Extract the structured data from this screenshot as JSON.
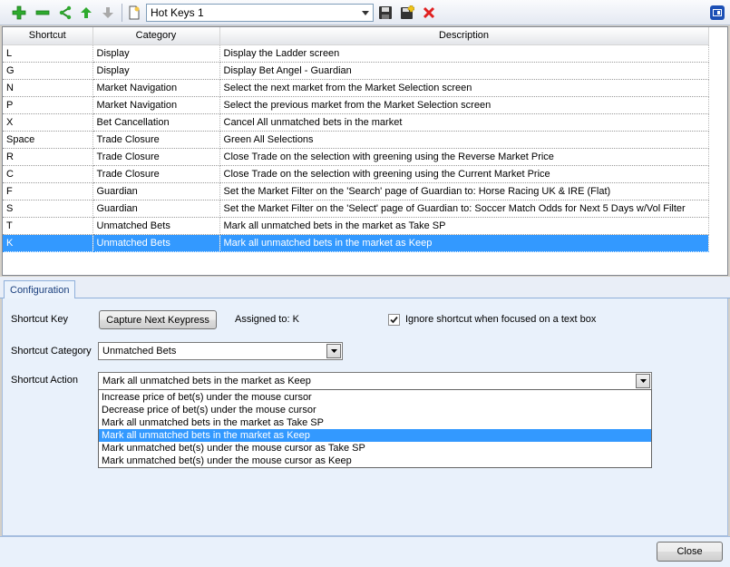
{
  "toolbar": {
    "buttons": [
      "add-icon",
      "remove-icon",
      "share-icon",
      "move-up-icon",
      "move-down-icon",
      "new-file-icon"
    ],
    "preset_name": "Hot Keys 1",
    "actions": [
      "save-icon",
      "save-as-icon",
      "delete-icon"
    ],
    "dock_icon": "dock-icon"
  },
  "grid": {
    "columns": [
      "Shortcut",
      "Category",
      "Description"
    ],
    "rows": [
      [
        "L",
        "Display",
        "Display the Ladder screen"
      ],
      [
        "G",
        "Display",
        "Display Bet Angel - Guardian"
      ],
      [
        "N",
        "Market Navigation",
        "Select the next market from the Market Selection screen"
      ],
      [
        "P",
        "Market Navigation",
        "Select the previous market from the Market Selection screen"
      ],
      [
        "X",
        "Bet Cancellation",
        "Cancel All unmatched bets in the market"
      ],
      [
        "Space",
        "Trade Closure",
        "Green All Selections"
      ],
      [
        "R",
        "Trade Closure",
        "Close Trade on the selection with greening using the Reverse Market Price"
      ],
      [
        "C",
        "Trade Closure",
        "Close Trade on the selection with greening using the Current Market Price"
      ],
      [
        "F",
        "Guardian",
        "Set the Market Filter on the 'Search' page of Guardian to: Horse Racing UK & IRE (Flat)"
      ],
      [
        "S",
        "Guardian",
        "Set the Market Filter on the 'Select' page of Guardian to: Soccer Match Odds for Next 5 Days w/Vol Filter"
      ],
      [
        "T",
        "Unmatched Bets",
        "Mark all unmatched bets in the market as Take SP"
      ],
      [
        "K",
        "Unmatched Bets",
        "Mark all unmatched bets in the market as Keep"
      ]
    ],
    "selected_index": 11
  },
  "tab": {
    "label": "Configuration"
  },
  "config": {
    "shortcut_key_label": "Shortcut Key",
    "capture_button": "Capture Next Keypress",
    "assigned_text": "Assigned to: K",
    "ignore_checkbox_label": "Ignore shortcut when focused on a text box",
    "ignore_checked": true,
    "category_label": "Shortcut Category",
    "category_value": "Unmatched Bets",
    "action_label": "Shortcut Action",
    "action_value": "Mark all unmatched bets in the market as Keep",
    "action_options": [
      "Increase price of bet(s) under the mouse cursor",
      "Decrease price of bet(s) under the mouse cursor",
      "Mark all unmatched bets in the market as Take SP",
      "Mark all unmatched bets in the market as Keep",
      "Mark unmatched bet(s) under the mouse cursor as Take SP",
      "Mark unmatched bet(s) under the mouse cursor as Keep"
    ],
    "selected_option_index": 3
  },
  "footer": {
    "close_button": "Close"
  },
  "colors": {
    "selection": "#3399ff",
    "add": "#2eaa2e",
    "delete": "#e02020",
    "dock": "#1c4fb5"
  }
}
